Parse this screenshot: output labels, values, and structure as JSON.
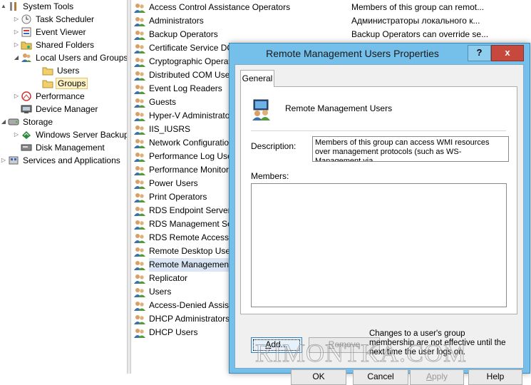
{
  "tree": {
    "items": [
      {
        "label": "System Tools",
        "icon": "system-tools-icon",
        "indent": 0,
        "arrow": "▲"
      },
      {
        "label": "Task Scheduler",
        "icon": "clock-icon",
        "indent": 1,
        "arrow": "▷"
      },
      {
        "label": "Event Viewer",
        "icon": "event-viewer-icon",
        "indent": 1,
        "arrow": "▷"
      },
      {
        "label": "Shared Folders",
        "icon": "shared-folder-icon",
        "indent": 1,
        "arrow": "▷"
      },
      {
        "label": "Local Users and Groups",
        "icon": "users-icon",
        "indent": 1,
        "arrow": "◢"
      },
      {
        "label": "Users",
        "icon": "folder-icon",
        "indent": 2,
        "arrow": ""
      },
      {
        "label": "Groups",
        "icon": "folder-icon",
        "indent": 2,
        "arrow": "",
        "selected": true
      },
      {
        "label": "Performance",
        "icon": "performance-icon",
        "indent": 1,
        "arrow": "▷"
      },
      {
        "label": "Device Manager",
        "icon": "device-manager-icon",
        "indent": 1,
        "arrow": ""
      },
      {
        "label": "Storage",
        "icon": "storage-icon",
        "indent": 0,
        "arrow": "◢"
      },
      {
        "label": "Windows Server Backup",
        "icon": "backup-icon",
        "indent": 1,
        "arrow": "▷"
      },
      {
        "label": "Disk Management",
        "icon": "disk-icon",
        "indent": 1,
        "arrow": ""
      },
      {
        "label": "Services and Applications",
        "icon": "services-icon",
        "indent": 0,
        "arrow": "▷"
      }
    ]
  },
  "groups": [
    {
      "name": "Access Control Assistance Operators",
      "desc": "Members of this group can remot..."
    },
    {
      "name": "Administrators",
      "desc": "Администраторы локального к..."
    },
    {
      "name": "Backup Operators",
      "desc": "Backup Operators can override se..."
    },
    {
      "name": "Certificate Service DCOM Access",
      "desc": ""
    },
    {
      "name": "Cryptographic Operators",
      "desc": ""
    },
    {
      "name": "Distributed COM Users",
      "desc": ""
    },
    {
      "name": "Event Log Readers",
      "desc": ""
    },
    {
      "name": "Guests",
      "desc": ""
    },
    {
      "name": "Hyper-V Administrators",
      "desc": ""
    },
    {
      "name": "IIS_IUSRS",
      "desc": ""
    },
    {
      "name": "Network Configuration Operators",
      "desc": ""
    },
    {
      "name": "Performance Log Users",
      "desc": ""
    },
    {
      "name": "Performance Monitor Users",
      "desc": ""
    },
    {
      "name": "Power Users",
      "desc": ""
    },
    {
      "name": "Print Operators",
      "desc": ""
    },
    {
      "name": "RDS Endpoint Servers",
      "desc": ""
    },
    {
      "name": "RDS Management Servers",
      "desc": ""
    },
    {
      "name": "RDS Remote Access Servers",
      "desc": ""
    },
    {
      "name": "Remote Desktop Users",
      "desc": ""
    },
    {
      "name": "Remote Management Users",
      "desc": "",
      "selected": true
    },
    {
      "name": "Replicator",
      "desc": ""
    },
    {
      "name": "Users",
      "desc": ""
    },
    {
      "name": "Access-Denied Assistance Users",
      "desc": ""
    },
    {
      "name": "DHCP Administrators",
      "desc": ""
    },
    {
      "name": "DHCP Users",
      "desc": ""
    }
  ],
  "dialog": {
    "title": "Remote Management Users Properties",
    "help_caption": "?",
    "close_caption": "x",
    "tab_general": "General",
    "group_name": "Remote Management Users",
    "description_label": "Description:",
    "description_value": "Members of this group can access WMI resources over management protocols (such as WS-Management via",
    "members_label": "Members:",
    "add_button": "Add...",
    "remove_button": "Remove",
    "membership_note": "Changes to a user's group membership are not effective until the next time the user logs on.",
    "ok_button": "OK",
    "cancel_button": "Cancel",
    "apply_button": "Apply",
    "help_button": "Help"
  },
  "watermark": "RIMONTKA.COM"
}
